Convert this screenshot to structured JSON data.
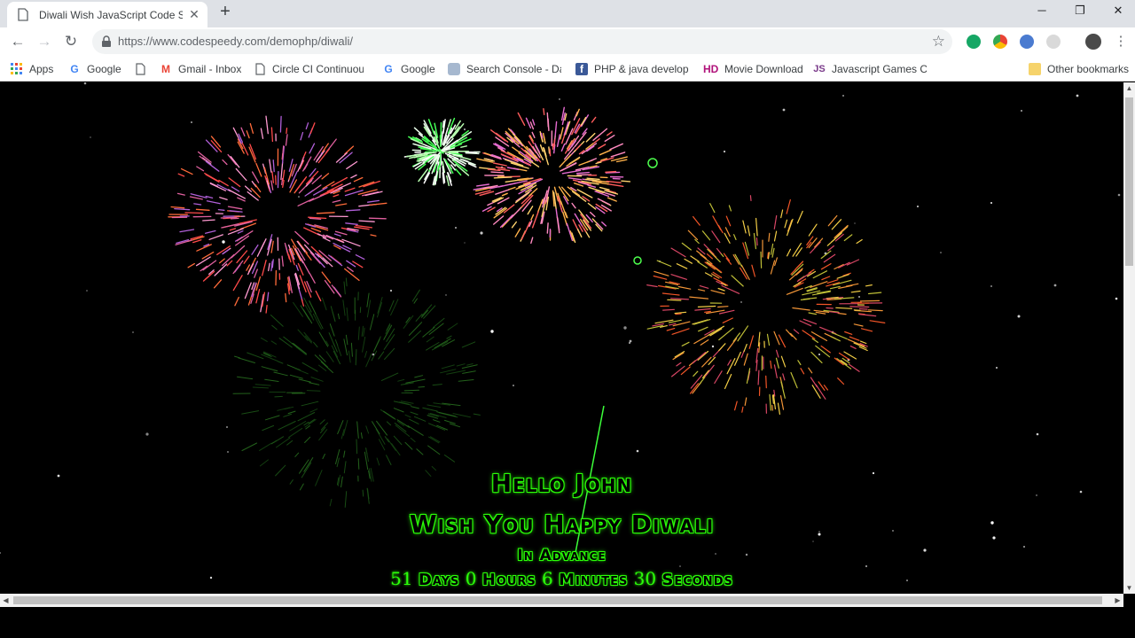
{
  "browser": {
    "tab_title": "Diwali Wish JavaScript Code Scri",
    "url": "https://www.codespeedy.com/demophp/diwali/",
    "bookmarks": [
      {
        "label": "Apps",
        "icon": "apps-grid-icon"
      },
      {
        "label": "Google",
        "icon": "google-icon"
      },
      {
        "label": "",
        "icon": "page-icon"
      },
      {
        "label": "Gmail - Inbox",
        "icon": "gmail-icon"
      },
      {
        "label": "Circle CI Continuous",
        "icon": "page-icon"
      },
      {
        "label": "Google",
        "icon": "google-icon"
      },
      {
        "label": "Search Console - Dat",
        "icon": "search-console-icon"
      },
      {
        "label": "PHP & java develope",
        "icon": "facebook-icon"
      },
      {
        "label": "Movie Download",
        "icon": "hd-icon"
      },
      {
        "label": "Javascript Games Co",
        "icon": "js-icon"
      }
    ],
    "other_bookmarks": "Other bookmarks"
  },
  "page": {
    "greeting": "Hello John",
    "wish": "Wish You Happy Diwali",
    "advance": "In Advance",
    "countdown": {
      "days": "51",
      "days_label": "Days",
      "hours": "0",
      "hours_label": "Hours",
      "minutes": "6",
      "minutes_label": "Minutes",
      "seconds": "30",
      "seconds_label": "Seconds"
    }
  },
  "colors": {
    "text_glow": "#2cff0a",
    "background": "#000000"
  }
}
